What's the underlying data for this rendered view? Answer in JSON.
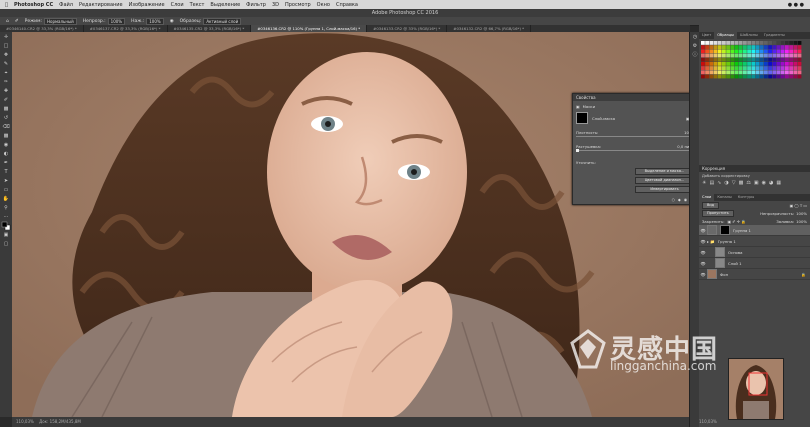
{
  "menubar": {
    "app": "Photoshop CC",
    "items": [
      "Файл",
      "Редактирование",
      "Изображение",
      "Слои",
      "Текст",
      "Выделение",
      "Фильтр",
      "3D",
      "Просмотр",
      "Окно",
      "Справка"
    ]
  },
  "window_title": "Adobe Photoshop CC 2016",
  "options": {
    "mode_label": "Режим:",
    "mode_value": "Нормальный",
    "opacity_label": "Непрозр.:",
    "opacity_value": "100%",
    "flow_label": "Наж.:",
    "flow_value": "100%",
    "sample_label": "Образец:",
    "sample_value": "Активный слой"
  },
  "tabs": [
    {
      "label": "#0346140.CR2 @ 33,3% (RGB/16*) *"
    },
    {
      "label": "#0346137.CR2 @ 33,3% (RGB/16*) *"
    },
    {
      "label": "#0346135.CR2 @ 33,3% (RGB/16*) *"
    },
    {
      "label": "#0346136.CR2 @ 110% (Группа 1, Слой-маска/16) *"
    },
    {
      "label": "#0346133.CR2 @ 33% (RGB/16*) *"
    },
    {
      "label": "#0346132.CR2 @ 66,7% (RGB/16*) *"
    }
  ],
  "status": {
    "zoom": "110,03%",
    "doc": "Док: 158,2M/435,8M"
  },
  "properties": {
    "title": "Свойства",
    "mask_label": "Маски",
    "layer_mask": "Слой-маска",
    "density_label": "Плотность:",
    "density_value": "100%",
    "feather_label": "Растушевка:",
    "feather_value": "0,0 пикс.",
    "refine_label": "Уточнить:",
    "btn_select_mask": "Выделение и маска...",
    "btn_color_range": "Цветовой диапазон...",
    "btn_invert": "Инвертировать"
  },
  "panels": {
    "swatch_tabs": [
      "Цвет",
      "Образцы",
      "Шаблоны",
      "Градиенты"
    ],
    "adjust_title": "Коррекция",
    "adjust_sub": "Добавить корректировку",
    "layer_tabs": [
      "Слои",
      "Каналы",
      "Контуры"
    ],
    "kind_label": "Вид",
    "blend_mode": "Пропустить",
    "opacity_label": "Непрозрачность:",
    "opacity_value": "100%",
    "lock_label": "Закрепить:",
    "fill_label": "Заливка:",
    "fill_value": "100%",
    "layers": [
      {
        "name": "Группа 1",
        "selected": true
      },
      {
        "name": "Группа 1",
        "selected": false
      },
      {
        "name": "Основа",
        "selected": false
      },
      {
        "name": "Слой 1",
        "selected": false
      },
      {
        "name": "Фон",
        "selected": false
      }
    ],
    "nav_zoom": "110,03%"
  },
  "watermark": {
    "cn": "灵感中国",
    "url": "lingganchina.com"
  },
  "colors": {
    "canvas_bg": "#a07d66",
    "panel_bg": "#535353",
    "accent": "#4a90d9"
  }
}
